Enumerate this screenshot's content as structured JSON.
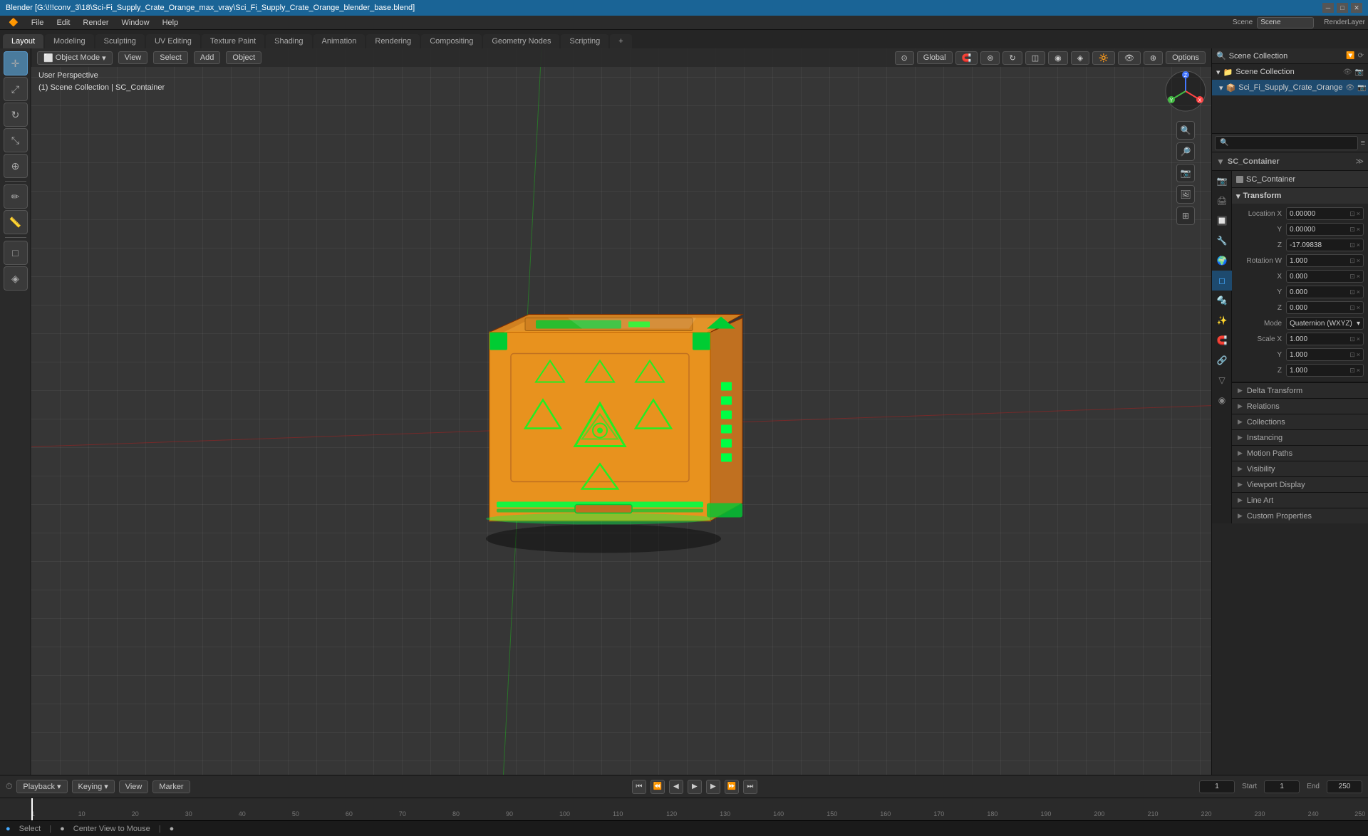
{
  "titlebar": {
    "title": "Blender [G:\\!!!conv_3\\18\\Sci-Fi_Supply_Crate_Orange_max_vray\\Sci_Fi_Supply_Crate_Orange_blender_base.blend]"
  },
  "menubar": {
    "items": [
      "Blender",
      "File",
      "Edit",
      "Render",
      "Window",
      "Help"
    ]
  },
  "workspace_tabs": [
    {
      "label": "Layout",
      "active": true
    },
    {
      "label": "Modeling"
    },
    {
      "label": "Sculpting"
    },
    {
      "label": "UV Editing"
    },
    {
      "label": "Texture Paint"
    },
    {
      "label": "Shading"
    },
    {
      "label": "Animation"
    },
    {
      "label": "Rendering"
    },
    {
      "label": "Compositing"
    },
    {
      "label": "Geometry Nodes"
    },
    {
      "label": "Scripting"
    },
    {
      "label": "+"
    }
  ],
  "viewport": {
    "mode_label": "Object Mode",
    "view_label": "View",
    "select_label": "Select",
    "add_label": "Add",
    "object_label": "Object",
    "view_info": "User Perspective",
    "collection_info": "(1) Scene Collection | SC_Container",
    "options_label": "Options"
  },
  "header_controls": {
    "transform_global": "Global",
    "pivot": "⊙"
  },
  "outliner": {
    "title": "Scene Collection",
    "items": [
      {
        "label": "Scene Collection",
        "icon": "📁",
        "indent": 0,
        "selected": false
      },
      {
        "label": "Sci_Fi_Supply_Crate_Orange",
        "icon": "📁",
        "indent": 1,
        "selected": false
      }
    ]
  },
  "properties": {
    "object_name": "SC_Container",
    "tab_icons": [
      "🎬",
      "🔧",
      "🔗",
      "✨",
      "🧲",
      "📦",
      "💡",
      "📷",
      "🌊",
      "🔩"
    ],
    "transform": {
      "title": "Transform",
      "location_x": "0.00000",
      "location_y": "0.00000",
      "location_z": "-17.09838",
      "rotation_w": "1.000",
      "rotation_x": "0.000",
      "rotation_y": "0.000",
      "rotation_z": "0.000",
      "mode": "Quaternion (WXYZ)",
      "scale_x": "1.000",
      "scale_y": "1.000",
      "scale_z": "1.000"
    },
    "sections": [
      {
        "label": "Delta Transform",
        "collapsed": true
      },
      {
        "label": "Relations",
        "collapsed": true
      },
      {
        "label": "Collections",
        "collapsed": true
      },
      {
        "label": "Instancing",
        "collapsed": true
      },
      {
        "label": "Motion Paths",
        "collapsed": true
      },
      {
        "label": "Visibility",
        "collapsed": true
      },
      {
        "label": "Viewport Display",
        "collapsed": true
      },
      {
        "label": "Line Art",
        "collapsed": true
      },
      {
        "label": "Custom Properties",
        "collapsed": true
      }
    ]
  },
  "timeline": {
    "playback_label": "Playback",
    "keying_label": "Keying",
    "view_label": "View",
    "marker_label": "Marker",
    "current_frame": "1",
    "start_label": "Start",
    "start_frame": "1",
    "end_label": "End",
    "end_frame": "250",
    "ruler_marks": [
      "1",
      "10",
      "20",
      "30",
      "40",
      "50",
      "60",
      "70",
      "80",
      "90",
      "100",
      "110",
      "120",
      "130",
      "140",
      "150",
      "160",
      "170",
      "180",
      "190",
      "200",
      "210",
      "220",
      "230",
      "240",
      "250"
    ]
  },
  "statusbar": {
    "select_label": "Select",
    "center_view_label": "Center View to Mouse"
  }
}
